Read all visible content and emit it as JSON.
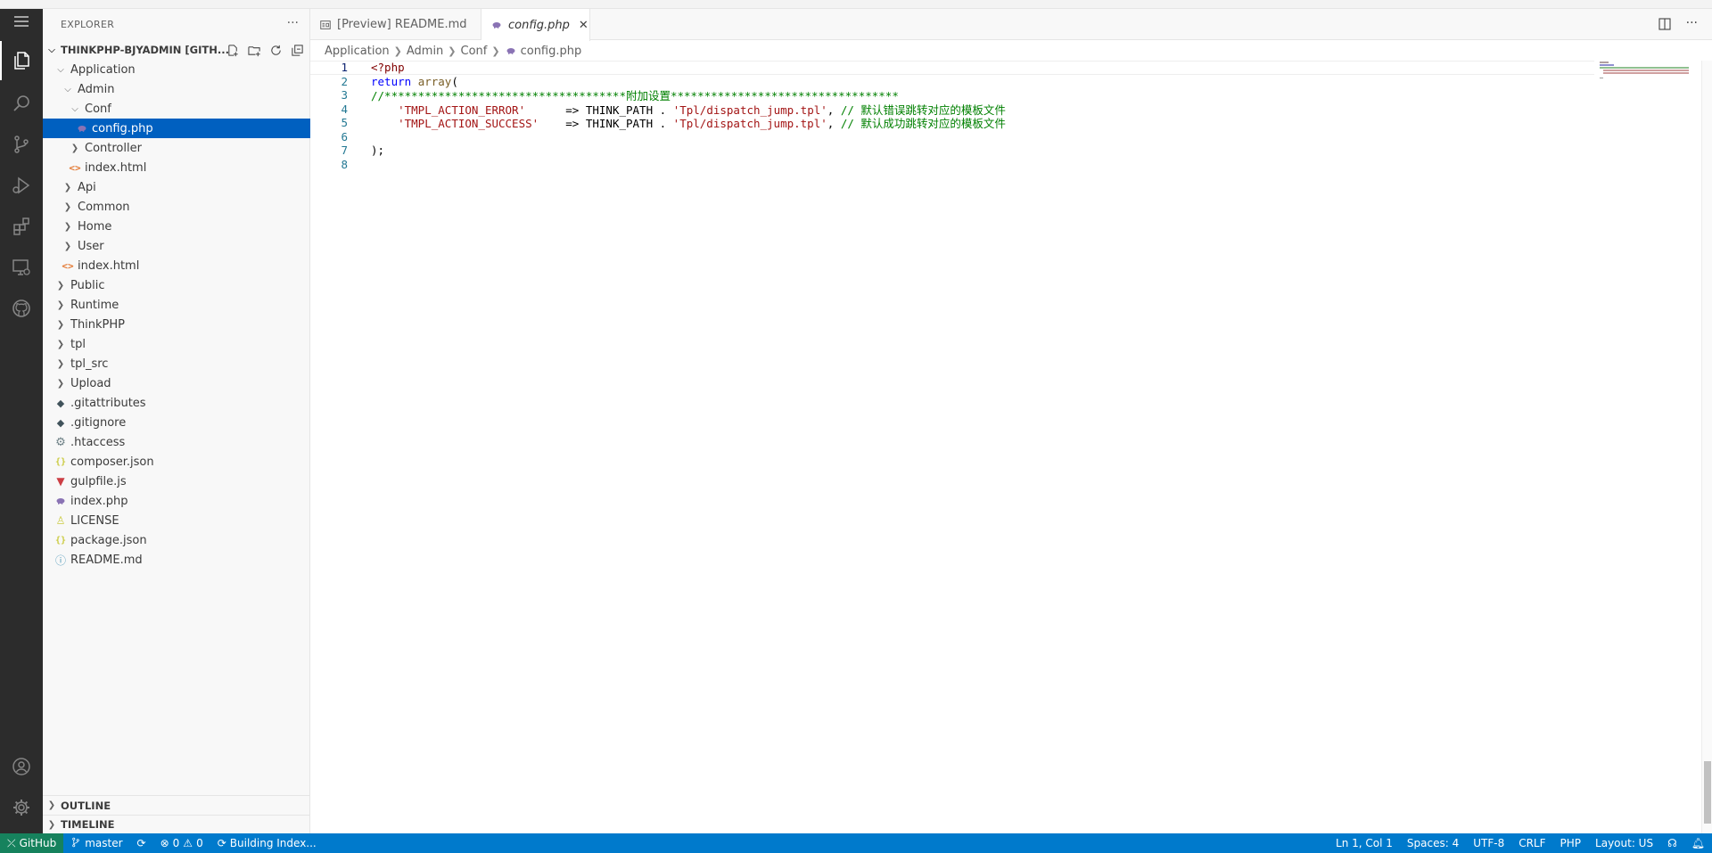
{
  "sidebar": {
    "title": "EXPLORER",
    "more": "···",
    "workspace": "THINKPHP-BJYADMIN [GITH...",
    "tree": [
      {
        "label": "Application",
        "depth": 1,
        "twisty": "open",
        "icon": "none"
      },
      {
        "label": "Admin",
        "depth": 2,
        "twisty": "open",
        "icon": "none"
      },
      {
        "label": "Conf",
        "depth": 3,
        "twisty": "open",
        "icon": "none"
      },
      {
        "label": "config.php",
        "depth": 4,
        "twisty": "none",
        "icon": "php-icon",
        "selected": true
      },
      {
        "label": "Controller",
        "depth": 3,
        "twisty": "closed",
        "icon": "none"
      },
      {
        "label": "index.html",
        "depth": 3,
        "twisty": "none",
        "icon": "html-icon"
      },
      {
        "label": "Api",
        "depth": 2,
        "twisty": "closed",
        "icon": "none"
      },
      {
        "label": "Common",
        "depth": 2,
        "twisty": "closed",
        "icon": "none"
      },
      {
        "label": "Home",
        "depth": 2,
        "twisty": "closed",
        "icon": "none"
      },
      {
        "label": "User",
        "depth": 2,
        "twisty": "closed",
        "icon": "none"
      },
      {
        "label": "index.html",
        "depth": 2,
        "twisty": "none",
        "icon": "html-icon"
      },
      {
        "label": "Public",
        "depth": 1,
        "twisty": "closed",
        "icon": "none"
      },
      {
        "label": "Runtime",
        "depth": 1,
        "twisty": "closed",
        "icon": "none"
      },
      {
        "label": "ThinkPHP",
        "depth": 1,
        "twisty": "closed",
        "icon": "none"
      },
      {
        "label": "tpl",
        "depth": 1,
        "twisty": "closed",
        "icon": "none"
      },
      {
        "label": "tpl_src",
        "depth": 1,
        "twisty": "closed",
        "icon": "none"
      },
      {
        "label": "Upload",
        "depth": 1,
        "twisty": "closed",
        "icon": "none"
      },
      {
        "label": ".gitattributes",
        "depth": 1,
        "twisty": "none",
        "icon": "git-icon"
      },
      {
        "label": ".gitignore",
        "depth": 1,
        "twisty": "none",
        "icon": "git-icon"
      },
      {
        "label": ".htaccess",
        "depth": 1,
        "twisty": "none",
        "icon": "gear-icon"
      },
      {
        "label": "composer.json",
        "depth": 1,
        "twisty": "none",
        "icon": "json-icon"
      },
      {
        "label": "gulpfile.js",
        "depth": 1,
        "twisty": "none",
        "icon": "gulp-icon"
      },
      {
        "label": "index.php",
        "depth": 1,
        "twisty": "none",
        "icon": "php-icon"
      },
      {
        "label": "LICENSE",
        "depth": 1,
        "twisty": "none",
        "icon": "license-icon"
      },
      {
        "label": "package.json",
        "depth": 1,
        "twisty": "none",
        "icon": "json-icon"
      },
      {
        "label": "README.md",
        "depth": 1,
        "twisty": "none",
        "icon": "info-icon"
      }
    ],
    "outline": "OUTLINE",
    "timeline": "TIMELINE"
  },
  "tabs": [
    {
      "label": "[Preview] README.md",
      "active": false
    },
    {
      "label": "config.php",
      "active": true
    }
  ],
  "breadcrumb": [
    "Application",
    "Admin",
    "Conf",
    "config.php"
  ],
  "editor": {
    "lines": [
      {
        "n": "1",
        "parts": [
          [
            "tag",
            "<?php"
          ]
        ]
      },
      {
        "n": "2",
        "parts": [
          [
            "kw",
            "return"
          ],
          [
            "plain",
            " "
          ],
          [
            "fn",
            "array"
          ],
          [
            "plain",
            "("
          ]
        ]
      },
      {
        "n": "3",
        "parts": [
          [
            "cm",
            "//************************************附加设置**********************************"
          ]
        ]
      },
      {
        "n": "4",
        "parts": [
          [
            "plain",
            "    "
          ],
          [
            "str",
            "'TMPL_ACTION_ERROR'"
          ],
          [
            "plain",
            "      => THINK_PATH . "
          ],
          [
            "str",
            "'Tpl/dispatch_jump.tpl'"
          ],
          [
            "plain",
            ", "
          ],
          [
            "cm",
            "// 默认错误跳转对应的模板文件"
          ]
        ]
      },
      {
        "n": "5",
        "parts": [
          [
            "plain",
            "    "
          ],
          [
            "str",
            "'TMPL_ACTION_SUCCESS'"
          ],
          [
            "plain",
            "    => THINK_PATH . "
          ],
          [
            "str",
            "'Tpl/dispatch_jump.tpl'"
          ],
          [
            "plain",
            ", "
          ],
          [
            "cm",
            "// 默认成功跳转对应的模板文件"
          ]
        ]
      },
      {
        "n": "6",
        "parts": []
      },
      {
        "n": "7",
        "parts": [
          [
            "plain",
            ");"
          ]
        ]
      },
      {
        "n": "8",
        "parts": []
      }
    ]
  },
  "statusbar": {
    "remote": "GitHub",
    "branch": "master",
    "errors": "0",
    "warnings": "0",
    "task": "Building Index...",
    "position": "Ln 1, Col 1",
    "spaces": "Spaces: 4",
    "encoding": "UTF-8",
    "eol": "CRLF",
    "language": "PHP",
    "layout": "Layout: US"
  },
  "colors": {
    "activitybar": "#2c2c2c",
    "selection": "#0060c0",
    "statusbar": "#007acc",
    "remote": "#16825d"
  }
}
